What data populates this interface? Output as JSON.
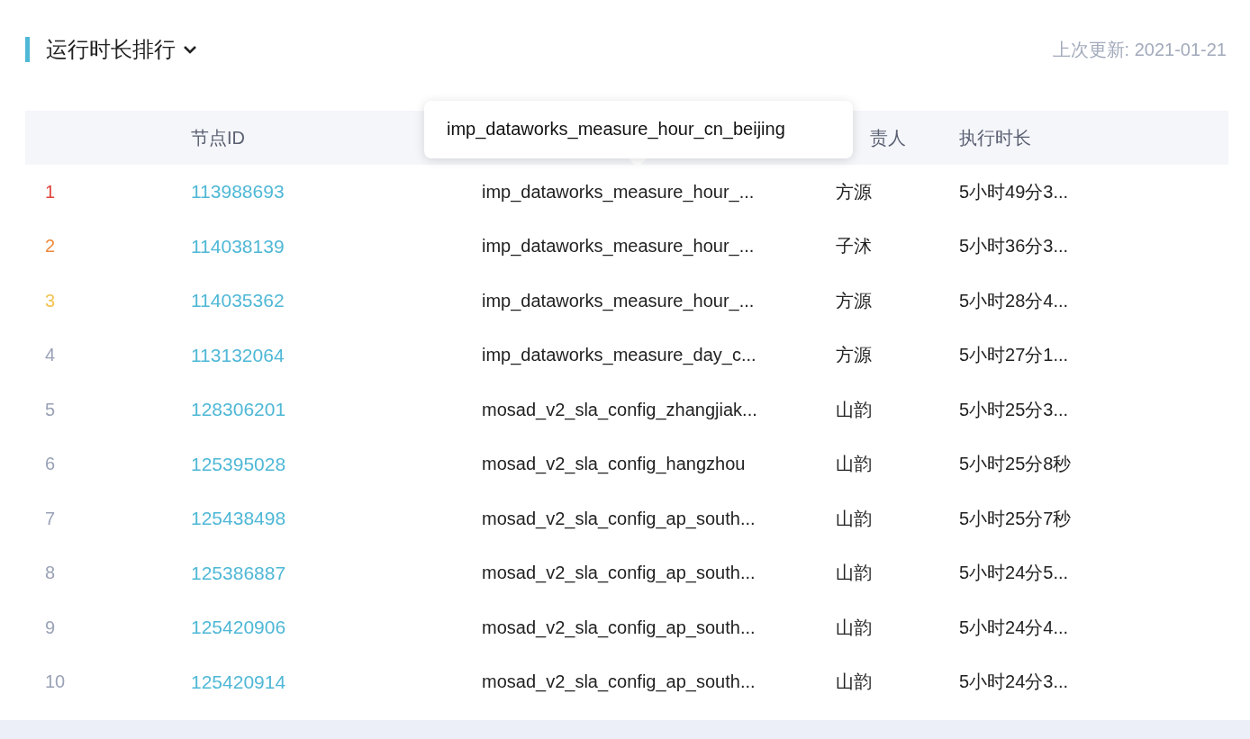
{
  "header": {
    "title": "运行时长排行",
    "last_updated": "上次更新: 2021-01-21"
  },
  "table": {
    "columns": [
      "节点ID",
      "责人",
      "执行时长"
    ],
    "rows": [
      {
        "rank": "1",
        "color": "#e0453c",
        "node_id": "113988693",
        "name": "imp_dataworks_measure_hour_...",
        "owner": "方源",
        "duration": "5小时49分3..."
      },
      {
        "rank": "2",
        "color": "#ef8a3d",
        "node_id": "114038139",
        "name": "imp_dataworks_measure_hour_...",
        "owner": "子沭",
        "duration": "5小时36分3..."
      },
      {
        "rank": "3",
        "color": "#f1c24f",
        "node_id": "114035362",
        "name": "imp_dataworks_measure_hour_...",
        "owner": "方源",
        "duration": "5小时28分4..."
      },
      {
        "rank": "4",
        "color": "#9aa2b6",
        "node_id": "113132064",
        "name": "imp_dataworks_measure_day_c...",
        "owner": "方源",
        "duration": "5小时27分1..."
      },
      {
        "rank": "5",
        "color": "#9aa2b6",
        "node_id": "128306201",
        "name": "mosad_v2_sla_config_zhangjiak...",
        "owner": "山韵",
        "duration": "5小时25分3..."
      },
      {
        "rank": "6",
        "color": "#9aa2b6",
        "node_id": "125395028",
        "name": "mosad_v2_sla_config_hangzhou",
        "owner": "山韵",
        "duration": "5小时25分8秒"
      },
      {
        "rank": "7",
        "color": "#9aa2b6",
        "node_id": "125438498",
        "name": "mosad_v2_sla_config_ap_south...",
        "owner": "山韵",
        "duration": "5小时25分7秒"
      },
      {
        "rank": "8",
        "color": "#9aa2b6",
        "node_id": "125386887",
        "name": "mosad_v2_sla_config_ap_south...",
        "owner": "山韵",
        "duration": "5小时24分5..."
      },
      {
        "rank": "9",
        "color": "#9aa2b6",
        "node_id": "125420906",
        "name": "mosad_v2_sla_config_ap_south...",
        "owner": "山韵",
        "duration": "5小时24分4..."
      },
      {
        "rank": "10",
        "color": "#9aa2b6",
        "node_id": "125420914",
        "name": "mosad_v2_sla_config_ap_south...",
        "owner": "山韵",
        "duration": "5小时24分3..."
      }
    ]
  },
  "tooltip": {
    "text": "imp_dataworks_measure_hour_cn_beijing"
  }
}
